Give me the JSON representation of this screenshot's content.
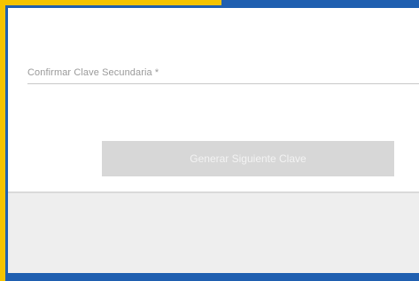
{
  "form": {
    "confirm_secondary_key_label": "Confirmar Clave Secundaria *",
    "confirm_secondary_key_value": ""
  },
  "actions": {
    "generate_button_label": "Generar Siguiente Clave"
  },
  "colors": {
    "frame_blue": "#1f5fb0",
    "frame_yellow": "#f5c400",
    "button_disabled": "#d7d7d7"
  }
}
